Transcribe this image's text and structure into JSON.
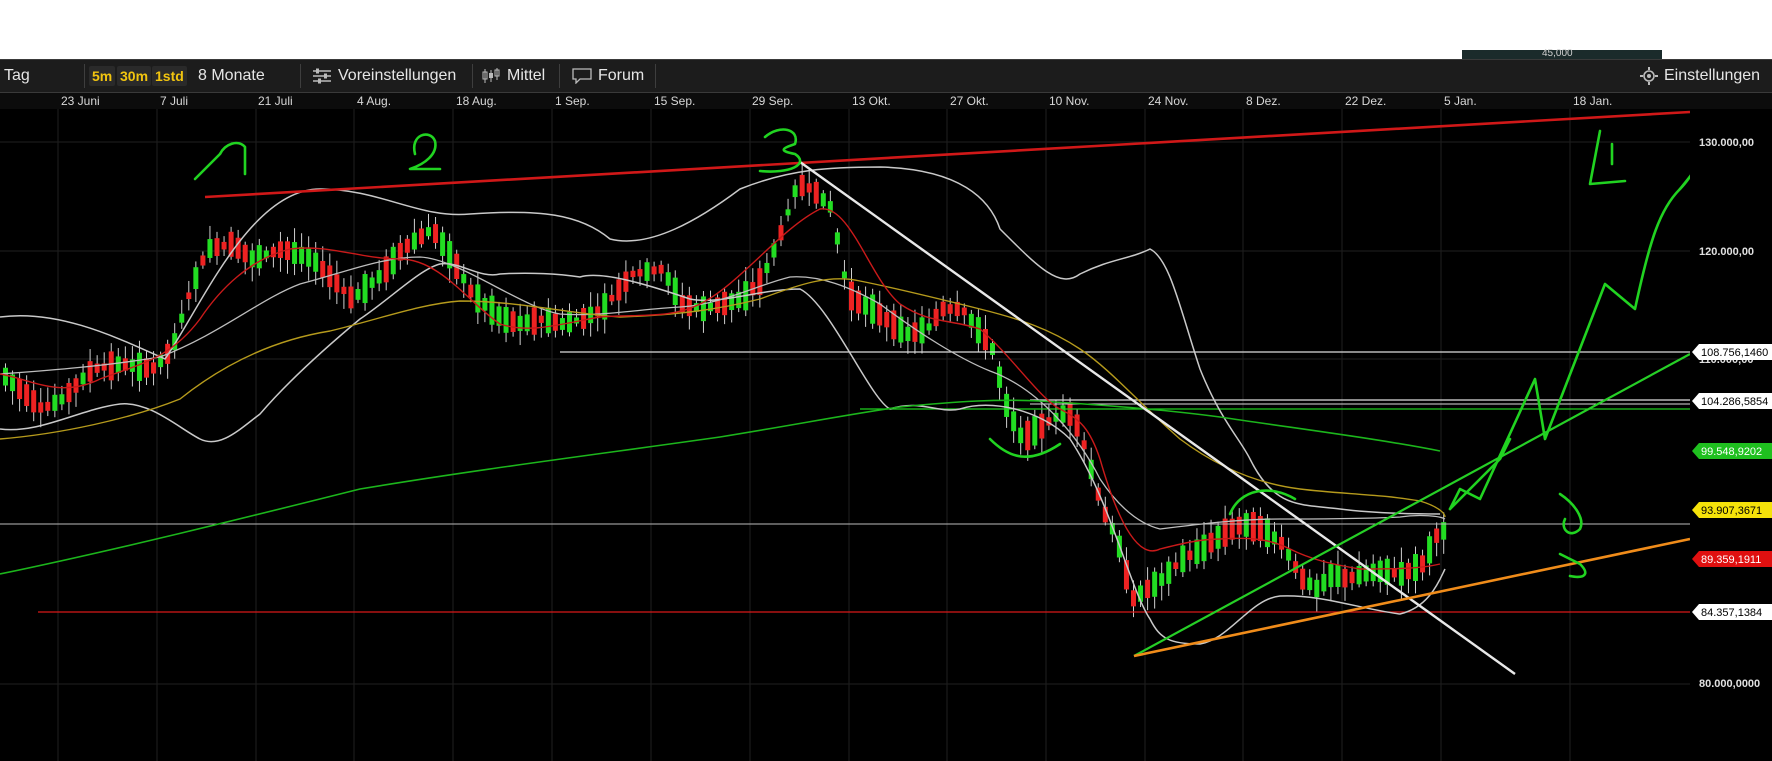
{
  "toolbar": {
    "period": "Tag",
    "timeframes": [
      "5m",
      "30m",
      "1std"
    ],
    "range": "8 Monate",
    "presets": "Voreinstellungen",
    "indicators": "Mittel",
    "forum": "Forum",
    "settings": "Einstellungen"
  },
  "header_sliver": "45,000",
  "dates": [
    "23 Juni",
    "7 Juli",
    "21 Juli",
    "4 Aug.",
    "18 Aug.",
    "1 Sep.",
    "15 Sep.",
    "29 Sep.",
    "13 Okt.",
    "27 Okt.",
    "10 Nov.",
    "24 Nov.",
    "8 Dez.",
    "22 Dez.",
    "5 Jan.",
    "18 Jan."
  ],
  "y_axis": [
    "130.000,00",
    "120.000,00",
    "110.000,00",
    "80.000,0000"
  ],
  "price_tags": [
    {
      "label": "108.756,1460",
      "bg": "#ffffff",
      "fg": "#000000"
    },
    {
      "label": "104.286,5854",
      "bg": "#ffffff",
      "fg": "#000000"
    },
    {
      "label": "99.548,9202",
      "bg": "#1fc01f",
      "fg": "#ffffff"
    },
    {
      "label": "93.907,3671",
      "bg": "#f5e20a",
      "fg": "#000000"
    },
    {
      "label": "89.359,1911",
      "bg": "#e01010",
      "fg": "#ffffff"
    },
    {
      "label": "84.357,1384",
      "bg": "#ffffff",
      "fg": "#000000"
    }
  ],
  "annotations": [
    "1",
    "2",
    "3",
    "4"
  ],
  "colors": {
    "background": "#000000",
    "up_candle": "#22dd22",
    "down_candle": "#ee2222",
    "resistance_line": "#d01818",
    "support_line": "#f08c1a",
    "drawing": "#21d321",
    "toolbar_accent": "#f1c40f"
  }
}
